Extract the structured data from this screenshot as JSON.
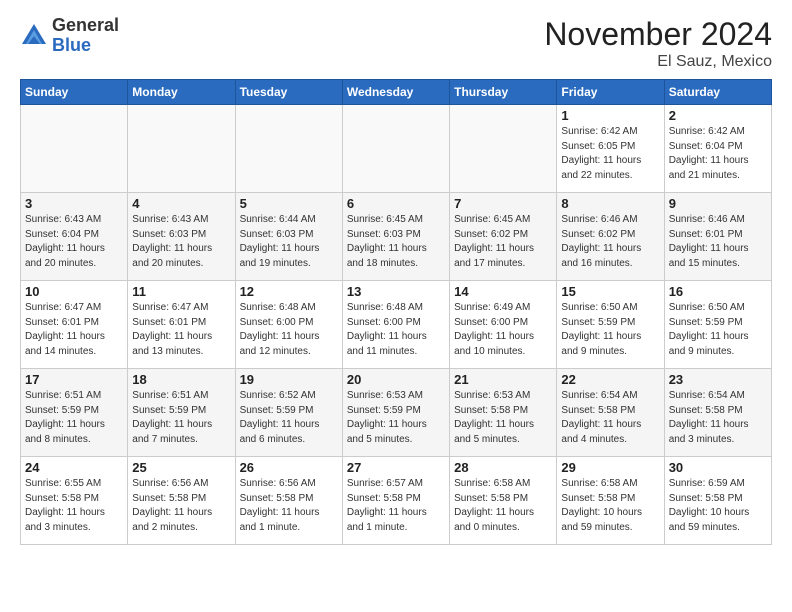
{
  "logo": {
    "general": "General",
    "blue": "Blue"
  },
  "header": {
    "month": "November 2024",
    "location": "El Sauz, Mexico"
  },
  "weekdays": [
    "Sunday",
    "Monday",
    "Tuesday",
    "Wednesday",
    "Thursday",
    "Friday",
    "Saturday"
  ],
  "weeks": [
    [
      {
        "day": "",
        "detail": ""
      },
      {
        "day": "",
        "detail": ""
      },
      {
        "day": "",
        "detail": ""
      },
      {
        "day": "",
        "detail": ""
      },
      {
        "day": "",
        "detail": ""
      },
      {
        "day": "1",
        "detail": "Sunrise: 6:42 AM\nSunset: 6:05 PM\nDaylight: 11 hours\nand 22 minutes."
      },
      {
        "day": "2",
        "detail": "Sunrise: 6:42 AM\nSunset: 6:04 PM\nDaylight: 11 hours\nand 21 minutes."
      }
    ],
    [
      {
        "day": "3",
        "detail": "Sunrise: 6:43 AM\nSunset: 6:04 PM\nDaylight: 11 hours\nand 20 minutes."
      },
      {
        "day": "4",
        "detail": "Sunrise: 6:43 AM\nSunset: 6:03 PM\nDaylight: 11 hours\nand 20 minutes."
      },
      {
        "day": "5",
        "detail": "Sunrise: 6:44 AM\nSunset: 6:03 PM\nDaylight: 11 hours\nand 19 minutes."
      },
      {
        "day": "6",
        "detail": "Sunrise: 6:45 AM\nSunset: 6:03 PM\nDaylight: 11 hours\nand 18 minutes."
      },
      {
        "day": "7",
        "detail": "Sunrise: 6:45 AM\nSunset: 6:02 PM\nDaylight: 11 hours\nand 17 minutes."
      },
      {
        "day": "8",
        "detail": "Sunrise: 6:46 AM\nSunset: 6:02 PM\nDaylight: 11 hours\nand 16 minutes."
      },
      {
        "day": "9",
        "detail": "Sunrise: 6:46 AM\nSunset: 6:01 PM\nDaylight: 11 hours\nand 15 minutes."
      }
    ],
    [
      {
        "day": "10",
        "detail": "Sunrise: 6:47 AM\nSunset: 6:01 PM\nDaylight: 11 hours\nand 14 minutes."
      },
      {
        "day": "11",
        "detail": "Sunrise: 6:47 AM\nSunset: 6:01 PM\nDaylight: 11 hours\nand 13 minutes."
      },
      {
        "day": "12",
        "detail": "Sunrise: 6:48 AM\nSunset: 6:00 PM\nDaylight: 11 hours\nand 12 minutes."
      },
      {
        "day": "13",
        "detail": "Sunrise: 6:48 AM\nSunset: 6:00 PM\nDaylight: 11 hours\nand 11 minutes."
      },
      {
        "day": "14",
        "detail": "Sunrise: 6:49 AM\nSunset: 6:00 PM\nDaylight: 11 hours\nand 10 minutes."
      },
      {
        "day": "15",
        "detail": "Sunrise: 6:50 AM\nSunset: 5:59 PM\nDaylight: 11 hours\nand 9 minutes."
      },
      {
        "day": "16",
        "detail": "Sunrise: 6:50 AM\nSunset: 5:59 PM\nDaylight: 11 hours\nand 9 minutes."
      }
    ],
    [
      {
        "day": "17",
        "detail": "Sunrise: 6:51 AM\nSunset: 5:59 PM\nDaylight: 11 hours\nand 8 minutes."
      },
      {
        "day": "18",
        "detail": "Sunrise: 6:51 AM\nSunset: 5:59 PM\nDaylight: 11 hours\nand 7 minutes."
      },
      {
        "day": "19",
        "detail": "Sunrise: 6:52 AM\nSunset: 5:59 PM\nDaylight: 11 hours\nand 6 minutes."
      },
      {
        "day": "20",
        "detail": "Sunrise: 6:53 AM\nSunset: 5:59 PM\nDaylight: 11 hours\nand 5 minutes."
      },
      {
        "day": "21",
        "detail": "Sunrise: 6:53 AM\nSunset: 5:58 PM\nDaylight: 11 hours\nand 5 minutes."
      },
      {
        "day": "22",
        "detail": "Sunrise: 6:54 AM\nSunset: 5:58 PM\nDaylight: 11 hours\nand 4 minutes."
      },
      {
        "day": "23",
        "detail": "Sunrise: 6:54 AM\nSunset: 5:58 PM\nDaylight: 11 hours\nand 3 minutes."
      }
    ],
    [
      {
        "day": "24",
        "detail": "Sunrise: 6:55 AM\nSunset: 5:58 PM\nDaylight: 11 hours\nand 3 minutes."
      },
      {
        "day": "25",
        "detail": "Sunrise: 6:56 AM\nSunset: 5:58 PM\nDaylight: 11 hours\nand 2 minutes."
      },
      {
        "day": "26",
        "detail": "Sunrise: 6:56 AM\nSunset: 5:58 PM\nDaylight: 11 hours\nand 1 minute."
      },
      {
        "day": "27",
        "detail": "Sunrise: 6:57 AM\nSunset: 5:58 PM\nDaylight: 11 hours\nand 1 minute."
      },
      {
        "day": "28",
        "detail": "Sunrise: 6:58 AM\nSunset: 5:58 PM\nDaylight: 11 hours\nand 0 minutes."
      },
      {
        "day": "29",
        "detail": "Sunrise: 6:58 AM\nSunset: 5:58 PM\nDaylight: 10 hours\nand 59 minutes."
      },
      {
        "day": "30",
        "detail": "Sunrise: 6:59 AM\nSunset: 5:58 PM\nDaylight: 10 hours\nand 59 minutes."
      }
    ]
  ]
}
